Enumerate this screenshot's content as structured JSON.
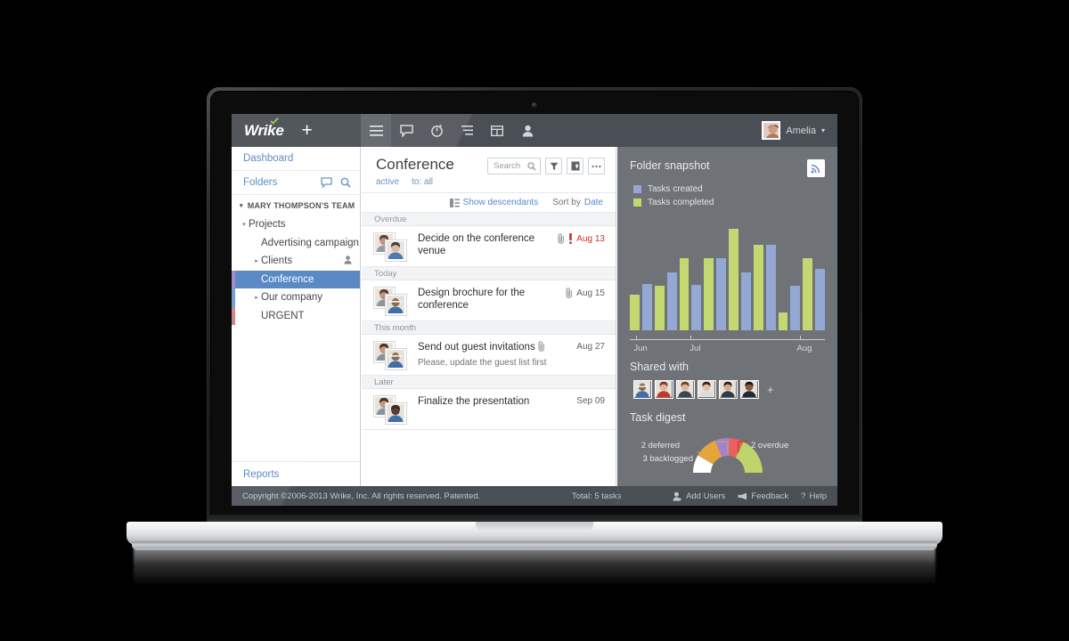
{
  "app": {
    "logo": "Wrike",
    "add_label": "+"
  },
  "toolbar": {
    "icons": [
      {
        "name": "menu-icon",
        "label": "Menu"
      },
      {
        "name": "chat-icon",
        "label": "Stream"
      },
      {
        "name": "timer-icon",
        "label": "Timer"
      },
      {
        "name": "gantt-icon",
        "label": "Gantt chart"
      },
      {
        "name": "table-icon",
        "label": "Table"
      },
      {
        "name": "person-icon",
        "label": "Workload"
      }
    ]
  },
  "user": {
    "name": "Amelia",
    "caret": "▾"
  },
  "sidebar": {
    "dashboard": "Dashboard",
    "folders": "Folders",
    "team": "MARY THOMPSON'S TEAM",
    "team_arrow": "▾",
    "reports": "Reports",
    "tree": [
      {
        "label": "Projects",
        "arrow": "▾",
        "indent": 0,
        "selected": false,
        "stripe": "",
        "shared": false
      },
      {
        "label": "Advertising campaign",
        "arrow": "",
        "indent": 1,
        "selected": false,
        "stripe": "",
        "shared": false
      },
      {
        "label": "Clients",
        "arrow": "▸",
        "indent": 1,
        "selected": false,
        "stripe": "",
        "shared": true
      },
      {
        "label": "Conference",
        "arrow": "",
        "indent": 1,
        "selected": true,
        "stripe": "#9b7fc4",
        "shared": false
      },
      {
        "label": "Our company",
        "arrow": "▸",
        "indent": 1,
        "selected": false,
        "stripe": "#6f94c9",
        "shared": false
      },
      {
        "label": "URGENT",
        "arrow": "",
        "indent": 1,
        "selected": false,
        "stripe": "#cc7a7e",
        "shared": false
      }
    ]
  },
  "center": {
    "title": "Conference",
    "filters": [
      "active",
      "to: all"
    ],
    "search_placeholder": "Search",
    "actions": [
      {
        "name": "filter-button",
        "label": "Filter"
      },
      {
        "name": "archive-button",
        "label": "Archive"
      },
      {
        "name": "more-button",
        "label": "More"
      }
    ],
    "show_descendants": "Show descendants",
    "sort_by_label": "Sort by",
    "sort_by_value": "Date",
    "groups": [
      {
        "label": "Overdue",
        "tasks": [
          {
            "title": "Decide on the conference venue",
            "desc": "",
            "date": "Aug 13",
            "overdue": true,
            "attachment": true,
            "attachment_inline": false,
            "priority": true,
            "avatar1": "#b98a74",
            "avatar2": "#d6b49c"
          }
        ]
      },
      {
        "label": "Today",
        "tasks": [
          {
            "title": "Design brochure for the conference",
            "desc": "",
            "date": "Aug 15",
            "overdue": false,
            "attachment": true,
            "attachment_inline": false,
            "priority": false,
            "avatar1": "#b98a74",
            "avatar2": "#3f6ea8"
          }
        ]
      },
      {
        "label": "This month",
        "tasks": [
          {
            "title": "Send out guest invitations",
            "desc": "Please, update the guest list first",
            "date": "Aug 27",
            "overdue": false,
            "attachment": false,
            "attachment_inline": true,
            "priority": false,
            "avatar1": "#c49a80",
            "avatar2": "#3f6ea8"
          }
        ]
      },
      {
        "label": "Later",
        "tasks": [
          {
            "title": "Finalize the presentation",
            "desc": "",
            "date": "Sep 09",
            "overdue": false,
            "attachment": false,
            "attachment_inline": false,
            "priority": false,
            "avatar1": "#c49a80",
            "avatar2": "#5a4034"
          }
        ]
      }
    ]
  },
  "right": {
    "snapshot_title": "Folder snapshot",
    "rss_label": "RSS feed",
    "shared_title": "Shared with",
    "shared_plus": "+",
    "shared_avatars": [
      "#4b6f9e",
      "#c38f82",
      "#b98a74",
      "#c9a493",
      "#8c9aa8",
      "#7b5a44"
    ],
    "digest_title": "Task digest",
    "digest": {
      "labels": [
        {
          "text": "3 backlogged",
          "color": "#ffffff"
        },
        {
          "text": "2 deferred",
          "color": "#a183cf"
        },
        {
          "text": "2 overdue",
          "color": "#e8615f"
        }
      ],
      "segments": [
        {
          "name": "backlogged-white",
          "color": "#ffffff",
          "value": 1
        },
        {
          "name": "backlogged-orange",
          "color": "#e3a53c",
          "value": 1.3
        },
        {
          "name": "deferred",
          "color": "#a183cf",
          "value": 0.8
        },
        {
          "name": "overdue",
          "color": "#e8615f",
          "value": 0.8
        },
        {
          "name": "active",
          "color": "#bfd46a",
          "value": 2.1
        }
      ]
    }
  },
  "chart_data": {
    "type": "bar",
    "title": "Folder snapshot",
    "xlabel": "",
    "ylabel": "",
    "ylim": [
      0,
      10
    ],
    "grid": false,
    "legend_position": "top-left",
    "colors": {
      "Tasks created": "#93a9d4",
      "Tasks completed": "#c3d870"
    },
    "categories": [
      "Jun",
      "Jul",
      "Aug"
    ],
    "tick_positions_pct": [
      3,
      31,
      87
    ],
    "groups": [
      "w1",
      "w2",
      "w3",
      "w4",
      "w5",
      "w6",
      "w7",
      "w8"
    ],
    "series": [
      {
        "name": "Tasks completed",
        "values": [
          3.2,
          4.0,
          6.5,
          6.5,
          9.1,
          7.7,
          1.6,
          6.5
        ]
      },
      {
        "name": "Tasks created",
        "values": [
          4.2,
          5.2,
          4.1,
          6.5,
          5.2,
          7.7,
          4.0,
          5.5
        ]
      }
    ],
    "bar_order": "completed-then-created",
    "legend": [
      "Tasks created",
      "Tasks completed"
    ]
  },
  "statusbar": {
    "copyright": "Copyright ©2006-2013 Wrike, Inc. All rights reserved. Patented.",
    "total": "Total: 5 tasks",
    "add_users": "Add Users",
    "feedback": "Feedback",
    "help": "Help",
    "help_mark": "?"
  }
}
